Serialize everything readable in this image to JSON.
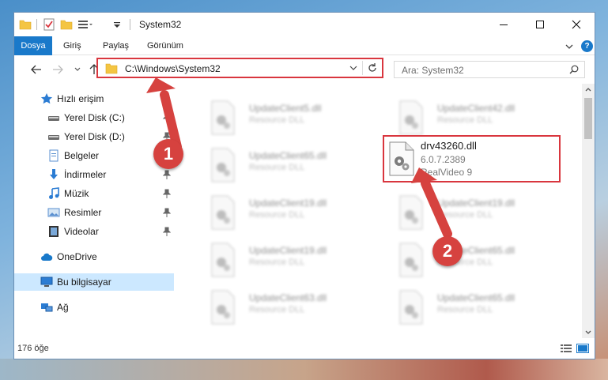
{
  "window": {
    "title": "System32",
    "controls": {
      "minimize": "minimize-icon",
      "maximize": "maximize-icon",
      "close": "close-icon"
    }
  },
  "ribbon": {
    "tabs": [
      {
        "label": "Dosya",
        "active": true
      },
      {
        "label": "Giriş"
      },
      {
        "label": "Paylaş"
      },
      {
        "label": "Görünüm"
      }
    ],
    "help": "?"
  },
  "navbar": {
    "address": "C:\\Windows\\System32",
    "search_placeholder": "Ara: System32"
  },
  "sidebar": {
    "items": [
      {
        "label": "Hızlı erişim",
        "icon": "star-icon"
      },
      {
        "label": "Yerel Disk (C:)",
        "icon": "drive-icon",
        "pinned": true
      },
      {
        "label": "Yerel Disk (D:)",
        "icon": "drive-icon",
        "pinned": true
      },
      {
        "label": "Belgeler",
        "icon": "documents-icon",
        "pinned": true
      },
      {
        "label": "İndirmeler",
        "icon": "download-icon",
        "pinned": true
      },
      {
        "label": "Müzik",
        "icon": "music-icon",
        "pinned": true
      },
      {
        "label": "Resimler",
        "icon": "pictures-icon",
        "pinned": true
      },
      {
        "label": "Videolar",
        "icon": "video-icon",
        "pinned": true
      },
      {
        "label": "OneDrive",
        "icon": "cloud-icon"
      },
      {
        "label": "Bu bilgisayar",
        "icon": "computer-icon",
        "selected": true
      },
      {
        "label": "Ağ",
        "icon": "network-icon"
      }
    ]
  },
  "files": {
    "blurred": [
      {
        "name": "UpdateClient5.dll",
        "desc": "Resource DLL"
      },
      {
        "name": "UpdateClient42.dll",
        "desc": "Resource DLL"
      },
      {
        "name": "UpdateClient65.dll",
        "desc": "Resource DLL"
      },
      {
        "name": "UpdateClient19.dll",
        "desc": "Resource DLL"
      },
      {
        "name": "UpdateClient19.dll",
        "desc": "Resource DLL"
      },
      {
        "name": "UpdateClient19.dll",
        "desc": "Resource DLL"
      },
      {
        "name": "UpdateClient65.dll",
        "desc": "Resource DLL"
      },
      {
        "name": "UpdateClient63.dll",
        "desc": "Resource DLL"
      },
      {
        "name": "UpdateClient65.dll",
        "desc": "Resource DLL"
      }
    ],
    "highlighted": {
      "name": "drv43260.dll",
      "version": "6.0.7.2389",
      "company": "RealVideo 9"
    }
  },
  "status": {
    "count": "176 öğe"
  },
  "annotations": {
    "step1": "1",
    "step2": "2"
  },
  "colors": {
    "accent": "#1979ca",
    "highlight": "#d9363e",
    "selected": "#cce8ff"
  }
}
